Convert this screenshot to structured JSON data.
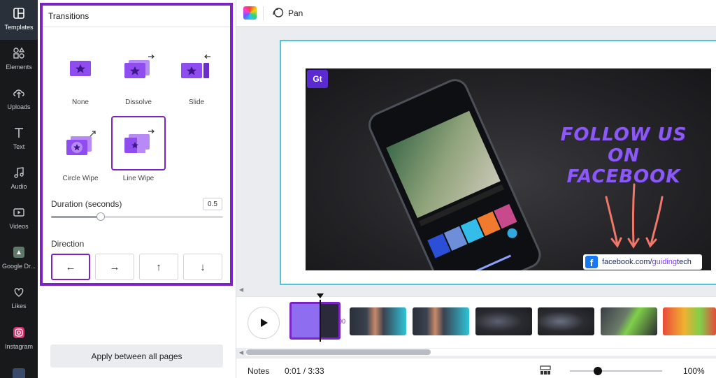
{
  "rail": {
    "items": [
      {
        "label": "Templates",
        "icon": "templates-icon",
        "active": true
      },
      {
        "label": "Elements",
        "icon": "elements-icon"
      },
      {
        "label": "Uploads",
        "icon": "uploads-icon"
      },
      {
        "label": "Text",
        "icon": "text-icon"
      },
      {
        "label": "Audio",
        "icon": "audio-icon"
      },
      {
        "label": "Videos",
        "icon": "videos-icon"
      },
      {
        "label": "Google Dr...",
        "icon": "google-drive-icon"
      },
      {
        "label": "Likes",
        "icon": "heart-icon"
      },
      {
        "label": "Instagram",
        "icon": "instagram-icon"
      }
    ]
  },
  "panel": {
    "title": "Transitions",
    "transitions": [
      {
        "label": "None",
        "selected": false
      },
      {
        "label": "Dissolve",
        "selected": false
      },
      {
        "label": "Slide",
        "selected": false
      },
      {
        "label": "Circle Wipe",
        "selected": false
      },
      {
        "label": "Line Wipe",
        "selected": true
      }
    ],
    "duration_label": "Duration (seconds)",
    "duration_value": "0.5",
    "duration_fraction": 0.29,
    "direction_label": "Direction",
    "directions": [
      {
        "glyph": "←",
        "icon": "arrow-left-icon",
        "selected": true
      },
      {
        "glyph": "→",
        "icon": "arrow-right-icon",
        "selected": false
      },
      {
        "glyph": "↑",
        "icon": "arrow-up-icon",
        "selected": false
      },
      {
        "glyph": "↓",
        "icon": "arrow-down-icon",
        "selected": false
      }
    ],
    "apply_label": "Apply between all pages"
  },
  "toolbar": {
    "pan_label": "Pan"
  },
  "canvas": {
    "logo_text": "Gt",
    "headline_line1": "FOLLOW US ON",
    "headline_line2": "FACEBOOK",
    "fb_prefix": "facebook.com/",
    "fb_handle_a": "guiding",
    "fb_handle_b": "tech",
    "colors": {
      "accent": "#7a24c4",
      "page_border": "#4fc6d8",
      "headline": "#8a5af2",
      "arrows": "#f0776a"
    }
  },
  "timeline": {
    "clips": [
      {
        "kind": "selected-purple"
      },
      {
        "kind": "person-teal"
      },
      {
        "kind": "person-teal"
      },
      {
        "kind": "dark-phone"
      },
      {
        "kind": "dark-phone"
      },
      {
        "kind": "hands-phone"
      },
      {
        "kind": "colorful"
      }
    ]
  },
  "bottombar": {
    "notes_label": "Notes",
    "time": "0:01 / 3:33",
    "zoom": "100%",
    "zoom_fraction": 0.3
  }
}
